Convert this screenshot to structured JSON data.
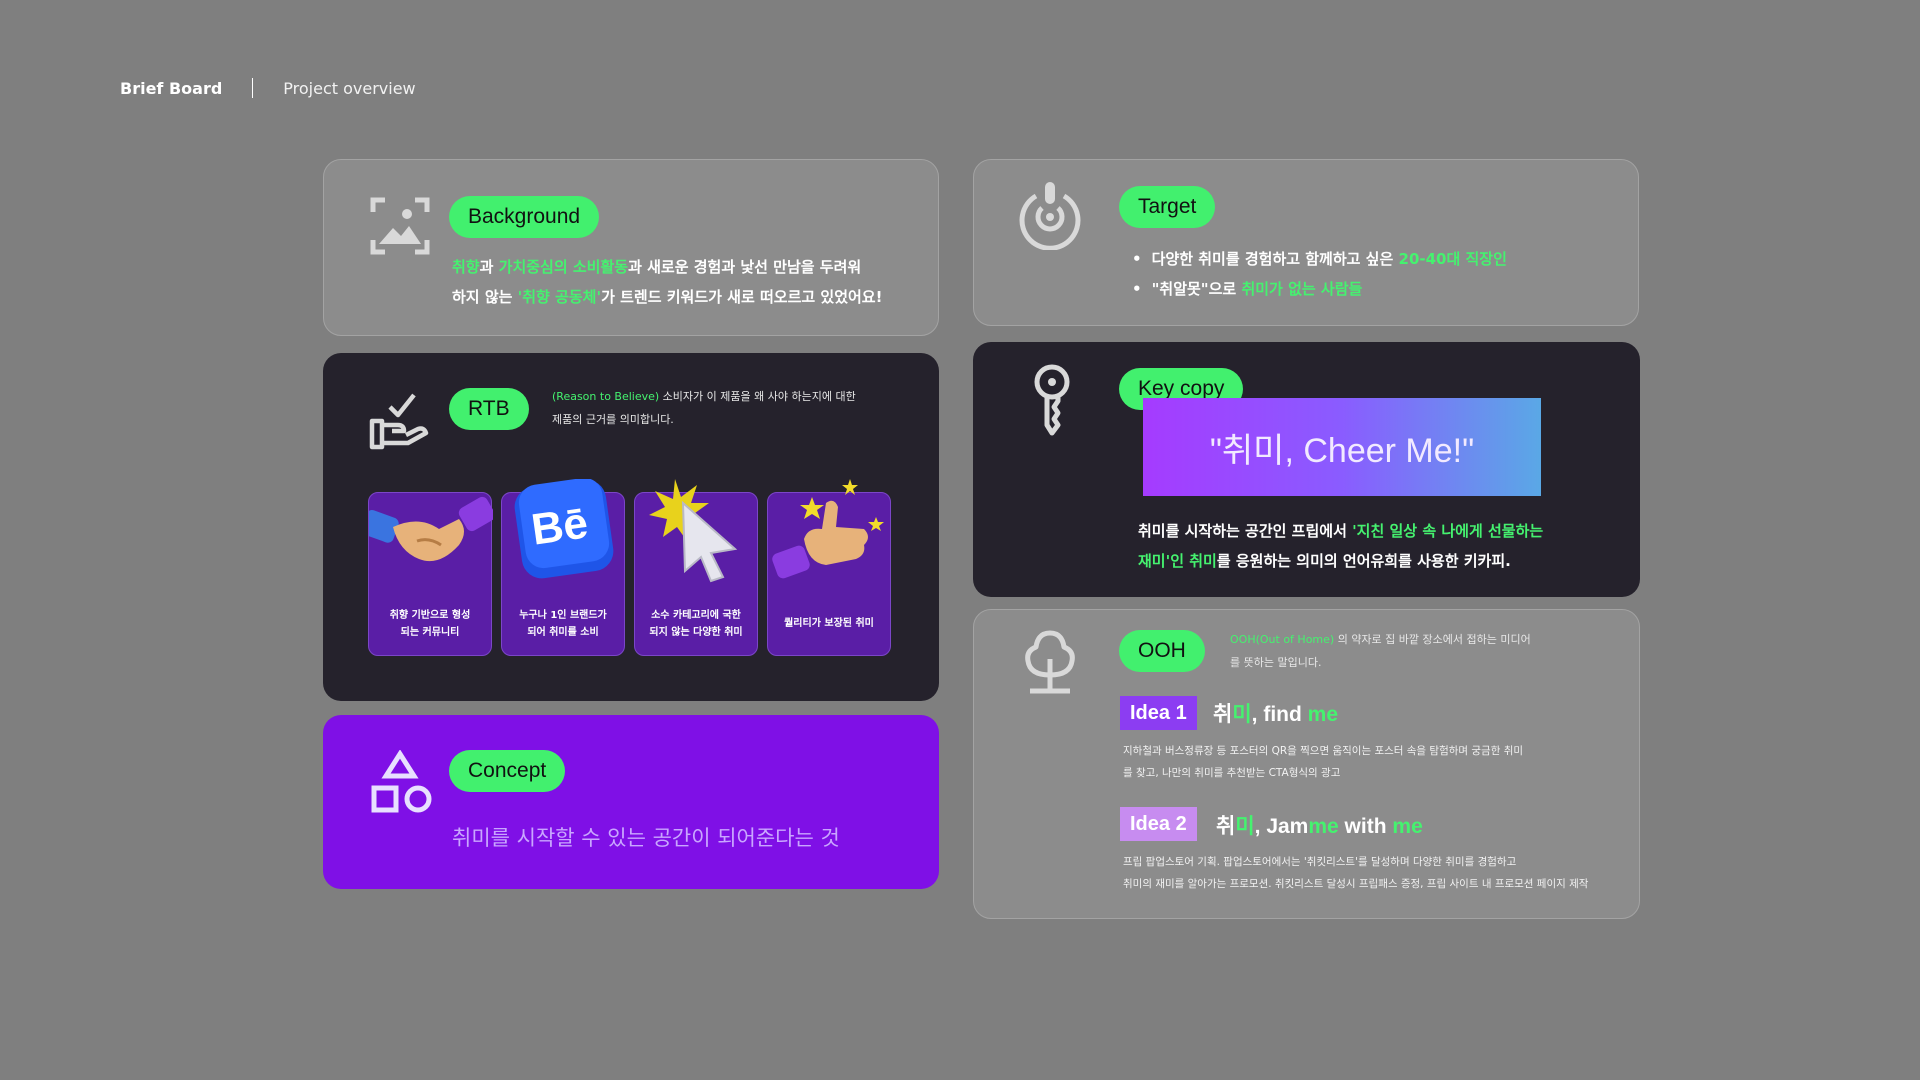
{
  "header": {
    "brand": "Brief Board",
    "subtitle": "Project overview"
  },
  "background": {
    "pill": "Background",
    "line1_a": "취향",
    "line1_b": "과 ",
    "line1_c": "가치중심의 소비활동",
    "line1_d": "과 새로운 경험과 낯선 만남을 두려워",
    "line2_a": "하지 않는 ",
    "line2_b": "'취향 공동체'",
    "line2_c": "가 트렌드 키워드가 새로 떠오르고 있었어요!"
  },
  "target": {
    "pill": "Target",
    "b1_a": "다양한 취미를 경험하고 함께하고 싶은 ",
    "b1_b": "20-40대 직장인",
    "b2_a": "\"취알못\"으로 ",
    "b2_b": "취미가 없는 사람들"
  },
  "rtb": {
    "pill": "RTB",
    "desc1_a": "(Reason to Believe)",
    "desc1_b": " 소비자가 이 제품을 왜 사야 하는지에 대한",
    "desc2": "제품의 근거를 의미합니다.",
    "tiles": [
      {
        "l1": "취향 기반으로 형성",
        "l2": "되는 커뮤니티",
        "icon": "handshake-icon"
      },
      {
        "l1": "누구나 1인 브랜드가",
        "l2": "되어 취미를 소비",
        "icon": "behance-icon"
      },
      {
        "l1": "소수 카테고리에 국한",
        "l2": "되지 않는 다양한 취미",
        "icon": "cursor-click-icon"
      },
      {
        "l1": "퀄리티가 보장된 취미",
        "l2": "",
        "icon": "thumbs-up-icon"
      }
    ]
  },
  "keycopy": {
    "pill": "Key copy",
    "copy": "\"취미, Cheer Me!\"",
    "line1_a": "취미를 시작하는 공간인 프립에서 ",
    "line1_b": "'지친 일상 속 나에게 선물하는",
    "line2_a": "재미'인 취미",
    "line2_b": "를 응원하는 의미의 언어유희를 사용한 키카피."
  },
  "concept": {
    "pill": "Concept",
    "text": "취미를 시작할 수 있는 공간이 되어준다는 것"
  },
  "ooh": {
    "pill": "OOH",
    "desc1_a": "OOH(Out of Home)",
    "desc1_b": " 의 약자로 집 바깥 장소에서 접하는 미디어",
    "desc2": "를 뜻하는 말입니다.",
    "idea1": {
      "tag": "Idea 1",
      "t1": "취",
      "t2": "미",
      "t3": ", find ",
      "t4": "me",
      "d1": "지하철과 버스정류장 등 포스터의 QR을 찍으면 움직이는 포스터 속을 탐험하며 궁금한 취미",
      "d2": "를 찾고, 나만의 취미를 추천받는 CTA형식의 광고"
    },
    "idea2": {
      "tag": "Idea 2",
      "t1": "취",
      "t2": "미",
      "t3": ", Jam",
      "t4": "me",
      "t5": " with ",
      "t6": "me",
      "d1": "프립 팝업스토어 기획. 팝업스토어에서는 '취킷리스트'를 달성하며 다양한 취미를 경험하고",
      "d2": "취미의 재미를 알아가는 프로모션. 취킷리스트 달성시 프립패스 증정, 프립 사이트 내 프로모션 페이지 제작"
    }
  },
  "colors": {
    "accent": "#42f06e",
    "purple": "#7f10e6",
    "dark": "#25222c",
    "grey_card": "#8c8c8c"
  }
}
